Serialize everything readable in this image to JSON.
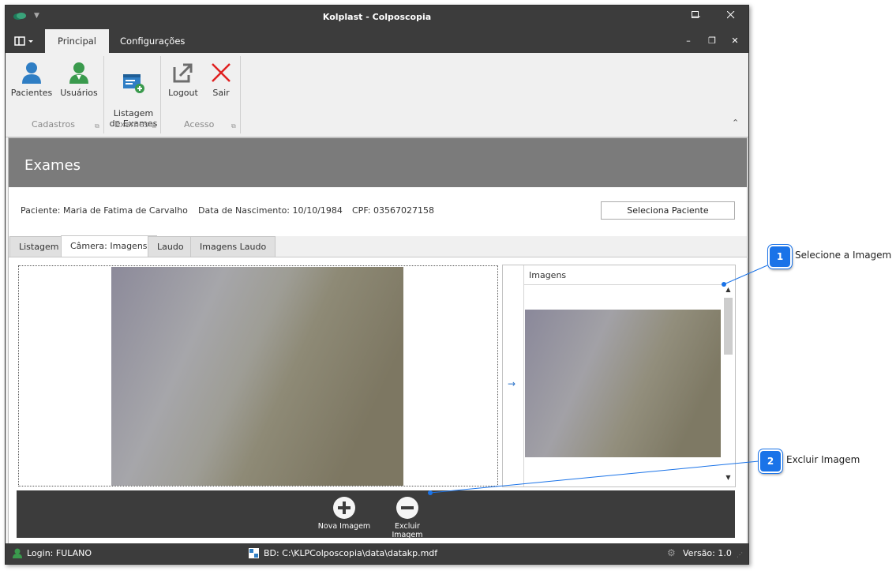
{
  "window": {
    "title": "Kolplast - Colposcopia",
    "controls": {
      "minimize": "—",
      "maximize": "☐",
      "close": "✕",
      "mdi_minimize": "–",
      "mdi_restore": "❐",
      "mdi_close": "✕"
    }
  },
  "ribbon": {
    "tabs": [
      {
        "label": "Principal",
        "active": true
      },
      {
        "label": "Configurações",
        "active": false
      }
    ],
    "groups": [
      {
        "label": "Cadastros",
        "buttons": [
          {
            "label": "Pacientes",
            "icon": "patient-icon"
          },
          {
            "label": "Usuários",
            "icon": "users-icon"
          }
        ]
      },
      {
        "label": "Exames",
        "buttons": [
          {
            "label": "Listagem\nde Exames",
            "icon": "exam-list-icon"
          }
        ]
      },
      {
        "label": "Acesso",
        "buttons": [
          {
            "label": "Logout",
            "icon": "logout-icon"
          },
          {
            "label": "Sair",
            "icon": "exit-icon"
          }
        ]
      }
    ],
    "collapse_glyph": "⌃"
  },
  "exams": {
    "header": "Exames",
    "patient": {
      "name": "Paciente: Maria de Fatima de Carvalho",
      "birth": "Data de Nascimento: 10/10/1984",
      "cpf": "CPF: 03567027158"
    },
    "select_patient_button": "Seleciona Paciente",
    "tabs": [
      {
        "label": "Listagem",
        "active": false
      },
      {
        "label": "Câmera: Imagens",
        "active": true
      },
      {
        "label": "Laudo",
        "active": false
      },
      {
        "label": "Imagens Laudo",
        "active": false
      }
    ],
    "grid": {
      "column": "Imagens",
      "row_indicator": "→"
    },
    "actions": {
      "add": "Nova Imagem",
      "remove": "Excluir Imagem"
    }
  },
  "status": {
    "login": "Login: FULANO",
    "db": "BD: C:\\KLPColposcopia\\data\\datakp.mdf",
    "version": "Versão: 1.0"
  },
  "callouts": [
    {
      "number": "1",
      "text": "Selecione a Imagem"
    },
    {
      "number": "2",
      "text": "Excluir Imagem"
    }
  ],
  "colors": {
    "accent": "#1a73e8",
    "dark": "#3c3c3c",
    "header_gray": "#7b7b7b"
  }
}
